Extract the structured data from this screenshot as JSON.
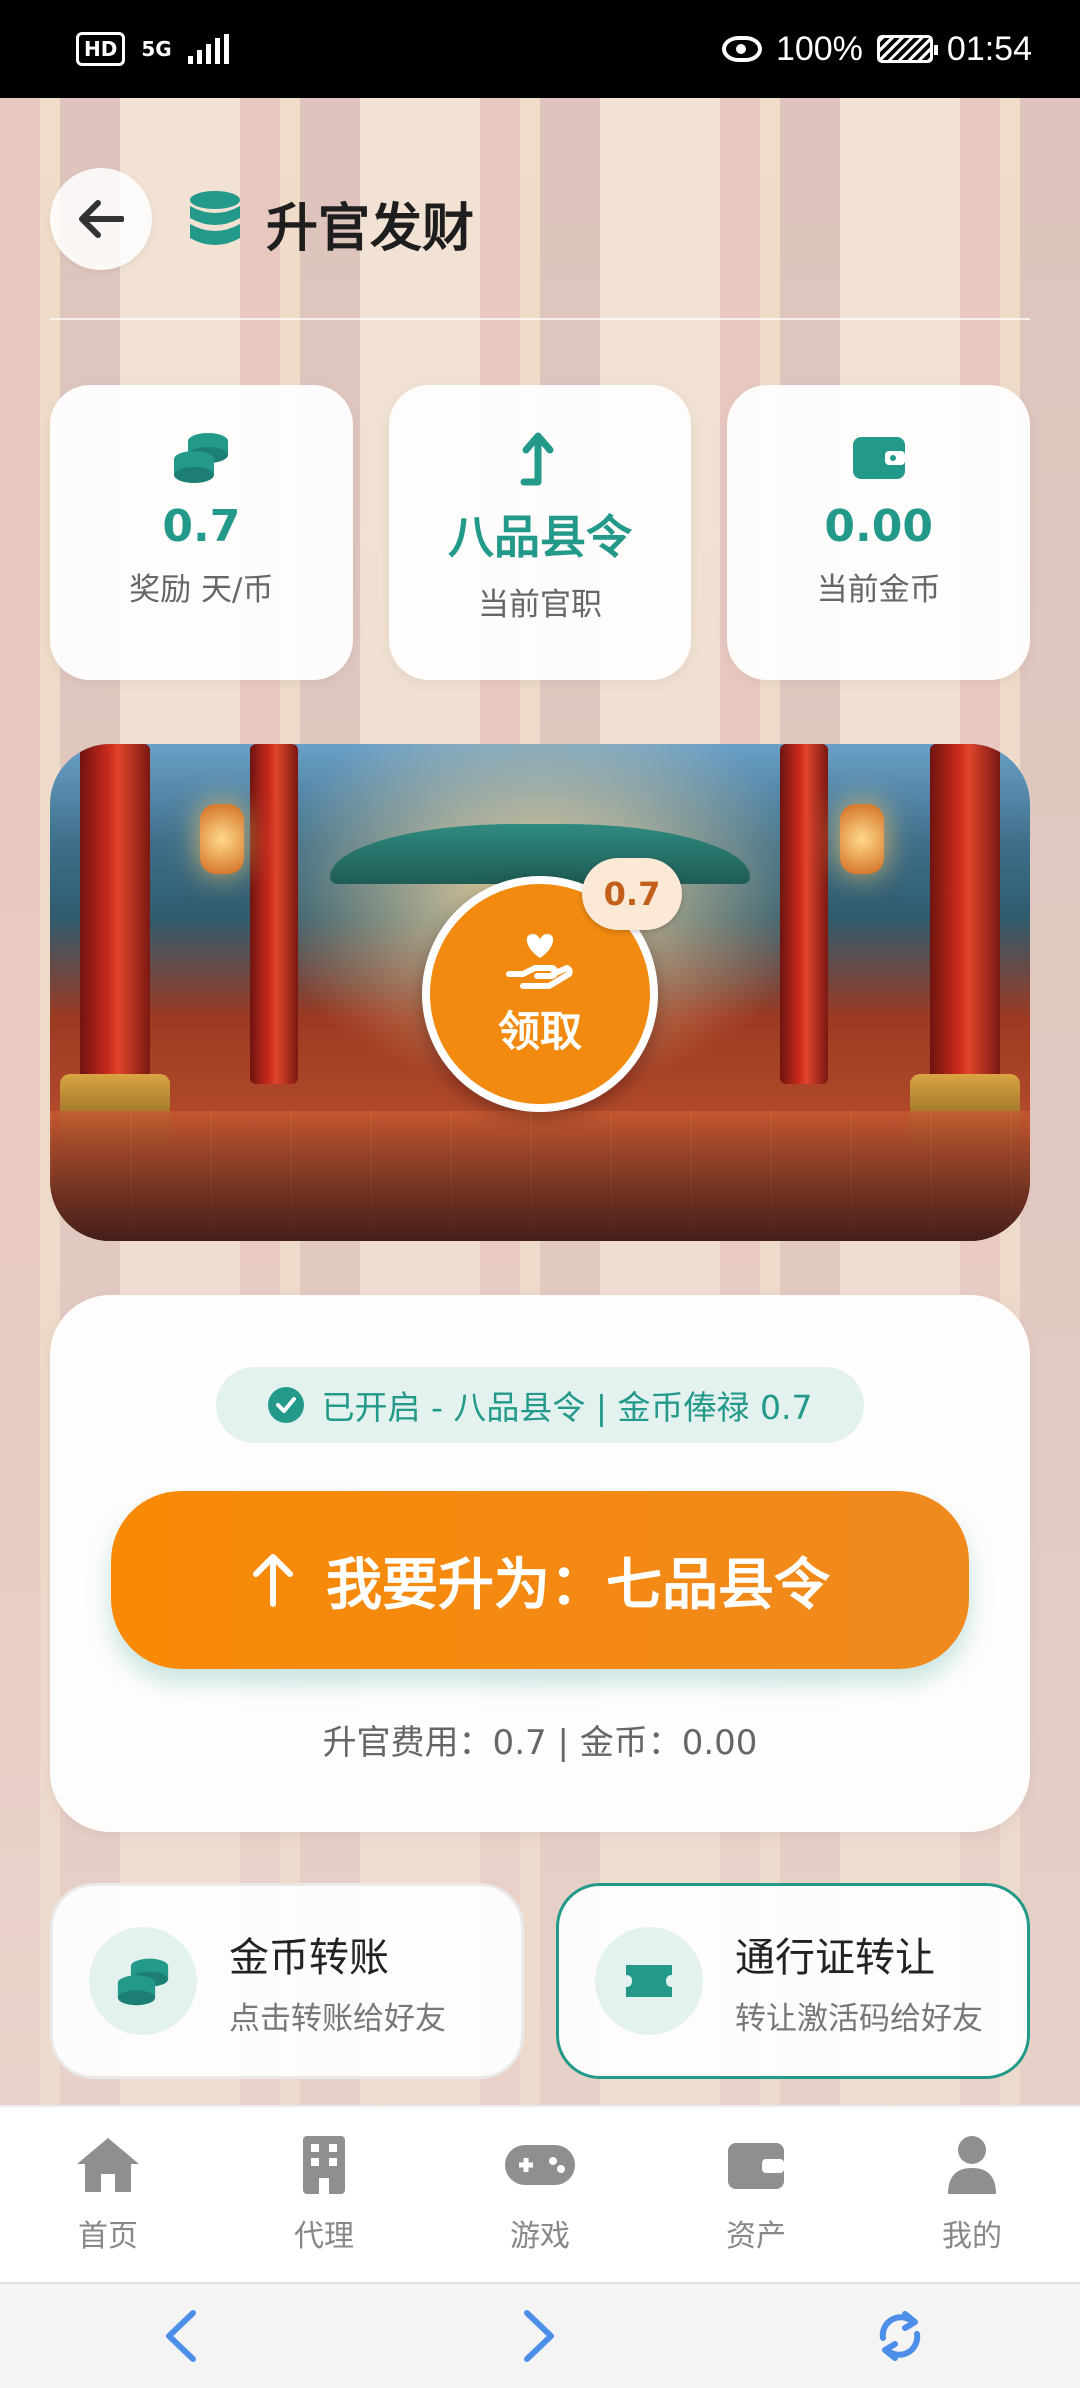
{
  "status_bar": {
    "hd": "HD",
    "network": "5G",
    "battery": "100%",
    "time": "01:54"
  },
  "header": {
    "title": "升官发财"
  },
  "stats": [
    {
      "value": "0.7",
      "label": "奖励 天/币",
      "icon": "coins-icon"
    },
    {
      "value": "八品县令",
      "label": "当前官职",
      "icon": "arrow-up-icon"
    },
    {
      "value": "0.00",
      "label": "当前金币",
      "icon": "wallet-icon"
    }
  ],
  "banner": {
    "claim_label": "领取",
    "claim_badge": "0.7"
  },
  "promo": {
    "status": "已开启 - 八品县令 | 金币俸禄 0.7",
    "button_label": "我要升为：七品县令",
    "cost": "升官费用：0.7 | 金币：0.00"
  },
  "actions": [
    {
      "title": "金币转账",
      "subtitle": "点击转账给好友"
    },
    {
      "title": "通行证转让",
      "subtitle": "转让激活码给好友"
    }
  ],
  "nav": [
    {
      "label": "首页",
      "icon": "home-icon"
    },
    {
      "label": "代理",
      "icon": "building-icon"
    },
    {
      "label": "游戏",
      "icon": "gamepad-icon"
    },
    {
      "label": "资产",
      "icon": "wallet-icon"
    },
    {
      "label": "我的",
      "icon": "user-icon"
    }
  ],
  "colors": {
    "accent": "#23998a",
    "orange": "#f28a10"
  }
}
